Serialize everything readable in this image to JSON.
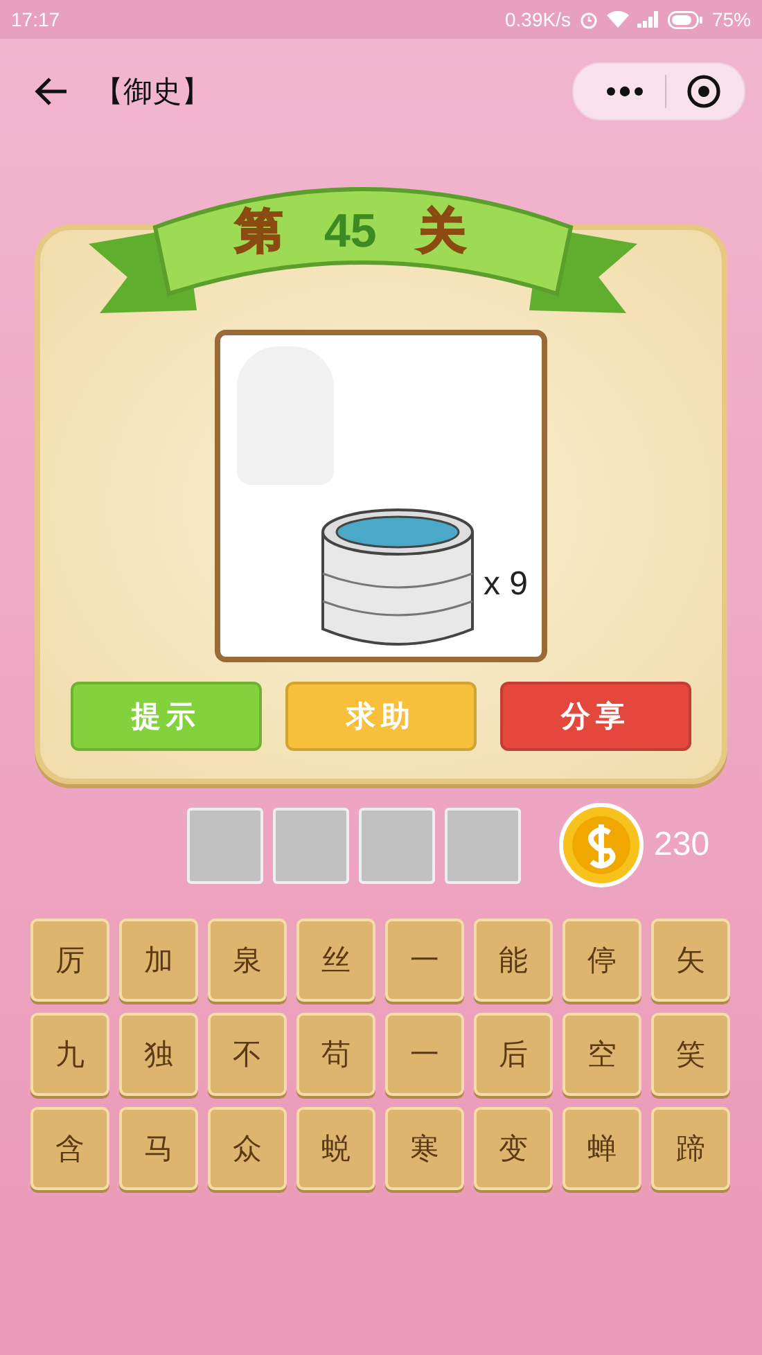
{
  "status_bar": {
    "time": "17:17",
    "speed": "0.39K/s",
    "battery": "75%"
  },
  "header": {
    "title": "【御史】"
  },
  "level_banner": {
    "prefix": "第",
    "number": "45",
    "suffix": "关"
  },
  "puzzle": {
    "multiplier": "x 9"
  },
  "buttons": [
    {
      "label": "提示",
      "kind": "hint"
    },
    {
      "label": "求助",
      "kind": "help"
    },
    {
      "label": "分享",
      "kind": "share"
    }
  ],
  "answer_slots": [
    {
      "filled": false
    },
    {
      "filled": false
    },
    {
      "filled": false
    },
    {
      "filled": false
    }
  ],
  "coins": "230",
  "letter_rows": [
    [
      "厉",
      "加",
      "泉",
      "丝",
      "一",
      "能",
      "停",
      "矢"
    ],
    [
      "九",
      "独",
      "不",
      "苟",
      "一",
      "后",
      "空",
      "笑"
    ],
    [
      "含",
      "马",
      "众",
      "蜕",
      "寒",
      "变",
      "蝉",
      "蹄"
    ]
  ]
}
